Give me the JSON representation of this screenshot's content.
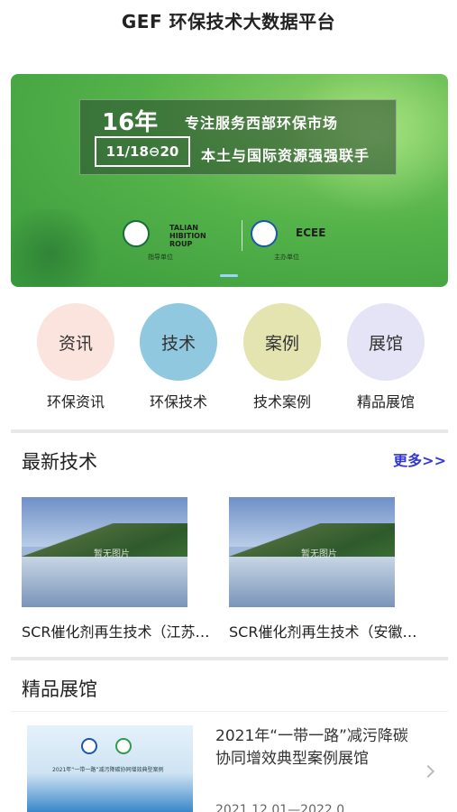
{
  "header": {
    "title": "GEF 环保技术大数据平台"
  },
  "banner": {
    "years": "16年",
    "slogan1": "专注服务西部环保市场",
    "date": "11/18⊖20",
    "slogan2": "本土与国际资源强强联手",
    "logo1_text": "TALIAN\nHIBITION\nROUP",
    "logo1_caption": "指导单位",
    "logo2_text": "ECEE",
    "logo2_caption": "主办单位"
  },
  "quick_nav": [
    {
      "circle_label": "资讯",
      "label": "环保资讯",
      "color": "#fbe4dd"
    },
    {
      "circle_label": "技术",
      "label": "环保技术",
      "color": "#8fc8df"
    },
    {
      "circle_label": "案例",
      "label": "技术案例",
      "color": "#e3e4b0"
    },
    {
      "circle_label": "展馆",
      "label": "精品展馆",
      "color": "#e4e4f6"
    }
  ],
  "latest_tech": {
    "title": "最新技术",
    "more": "更多>>",
    "items": [
      {
        "name": "SCR催化剂再生技术（江苏…",
        "watermark": "暂无图片"
      },
      {
        "name": "SCR催化剂再生技术（安徽…",
        "watermark": "暂无图片"
      }
    ]
  },
  "exhibition": {
    "title": "精品展馆",
    "item": {
      "title": "2021年“一带一路”减污降碳协同增效典型案例展馆",
      "date": "2021.12.01—2022.0",
      "image_caption": "2021年“一带一路”减污降碳协同增效典型案例"
    }
  }
}
